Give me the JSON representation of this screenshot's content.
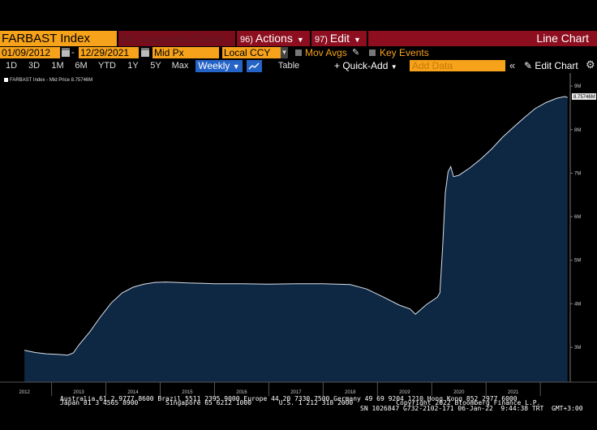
{
  "toolbar": {
    "ticker": "FARBAST Index",
    "suggested": "94) Suggested Charts",
    "actions_num": "96)",
    "actions_label": "Actions",
    "edit_num": "97)",
    "edit_label": "Edit",
    "title": "Line Chart",
    "start_date": "01/09/2012",
    "dash": "-",
    "end_date": "12/29/2021",
    "price_type": "Mid Px",
    "currency": "Local CCY",
    "mov_avgs": "Mov Avgs",
    "key_events": "Key Events",
    "ranges": [
      "1D",
      "3D",
      "1M",
      "6M",
      "YTD",
      "1Y",
      "5Y",
      "Max"
    ],
    "frequency": "Weekly",
    "table": "Table",
    "quick_add": "+ Quick-Add",
    "add_data_placeholder": "Add Data",
    "edit_chart": "Edit Chart"
  },
  "legend": {
    "text": "FARBAST Index - Mid Price 8.75746M"
  },
  "chart_data": {
    "type": "area",
    "series": [
      {
        "name": "FARBAST Index - Mid Price",
        "last_value_label": "8.75746M",
        "x": [
          2012.0,
          2012.2,
          2012.4,
          2012.6,
          2012.8,
          2012.9,
          2013.0,
          2013.2,
          2013.4,
          2013.6,
          2013.8,
          2014.0,
          2014.2,
          2014.4,
          2014.6,
          2014.8,
          2015.0,
          2015.5,
          2016.0,
          2016.5,
          2017.0,
          2017.5,
          2018.0,
          2018.3,
          2018.6,
          2018.9,
          2019.1,
          2019.2,
          2019.4,
          2019.6,
          2019.65,
          2019.7,
          2019.75,
          2019.8,
          2019.85,
          2019.9,
          2020.0,
          2020.2,
          2020.4,
          2020.6,
          2020.8,
          2021.0,
          2021.2,
          2021.4,
          2021.6,
          2021.8,
          2021.95,
          2022.0
        ],
        "y": [
          2.93,
          2.88,
          2.85,
          2.84,
          2.82,
          2.87,
          3.05,
          3.35,
          3.7,
          4.02,
          4.25,
          4.38,
          4.45,
          4.49,
          4.5,
          4.49,
          4.48,
          4.46,
          4.46,
          4.45,
          4.46,
          4.46,
          4.44,
          4.34,
          4.16,
          3.97,
          3.88,
          3.76,
          3.98,
          4.15,
          4.25,
          5.3,
          6.55,
          7.03,
          7.15,
          6.92,
          6.95,
          7.12,
          7.32,
          7.55,
          7.82,
          8.05,
          8.27,
          8.48,
          8.62,
          8.72,
          8.76,
          8.74
        ]
      }
    ],
    "y_ticks": [
      "9M",
      "8M",
      "7M",
      "6M",
      "5M",
      "4M",
      "3M"
    ],
    "y_tick_values": [
      9,
      8,
      7,
      6,
      5,
      4,
      3
    ],
    "x_ticks": [
      "2012",
      "2013",
      "2014",
      "2015",
      "2016",
      "2017",
      "2018",
      "2019",
      "2020",
      "2021"
    ],
    "x_tick_values": [
      2012.0,
      2013.0,
      2014.0,
      2015.0,
      2016.0,
      2017.0,
      2018.0,
      2019.0,
      2020.0,
      2021.0
    ],
    "ylim": [
      2.2,
      9.3
    ],
    "xlim": [
      2011.55,
      2022.05
    ],
    "fill_color": "#0e2742",
    "line_color": "#d9e2ee",
    "grid": false
  },
  "footer": {
    "line1": "Australia 61 2 9777 8600 Brazil 5511 2395 9000 Europe 44 20 7330 7500 Germany 49 69 9204 1210 Hong Kong 852 2977 6000",
    "line2": "Japan 81 3 4565 8900       Singapore 65 6212 1000       U.S. 1 212 318 2000           Copyright 2022 Bloomberg Finance L.P.",
    "line3": "SN 1026847 G732-2102-171 06-Jan-22  9:44:38 TRT  GMT+3:00"
  },
  "colors": {
    "orange": "#f7a21b",
    "menu_red": "#8c0e1f",
    "highlight_blue": "#2563c7"
  }
}
